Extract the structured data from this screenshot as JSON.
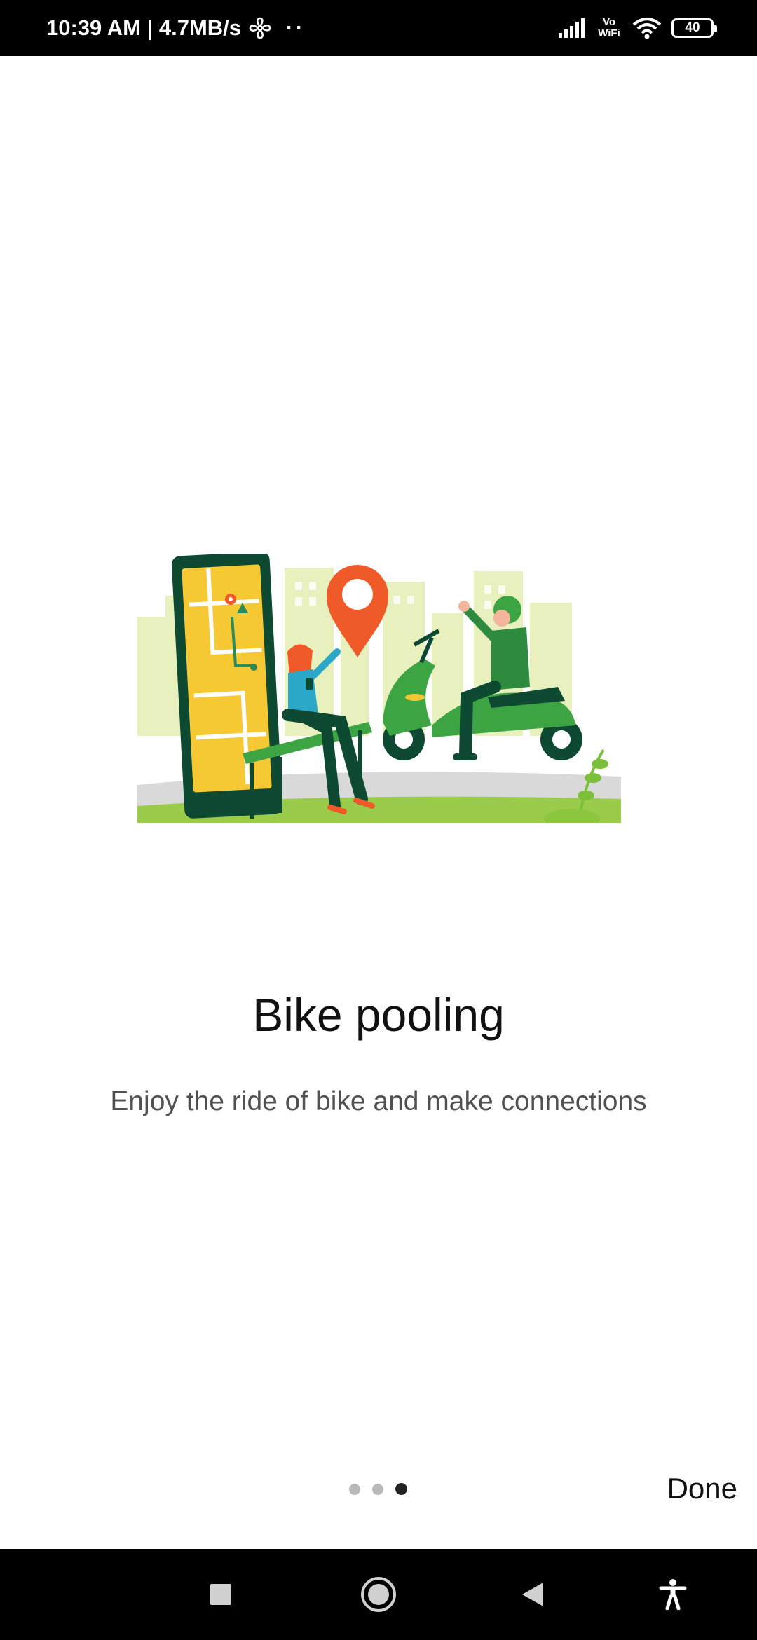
{
  "status_bar": {
    "time_speed": "10:39 AM | 4.7MB/s",
    "overflow_dots": "··",
    "vowifi_top": "Vo",
    "vowifi_bottom": "WiFi",
    "battery_level": "40",
    "icons": [
      "fan-icon",
      "signal-icon",
      "vowifi-icon",
      "wifi-icon",
      "battery-icon"
    ]
  },
  "onboarding": {
    "illustration": "bike-pooling-illustration",
    "title": "Bike pooling",
    "subtitle": "Enjoy the ride of bike and make connections",
    "pager": {
      "total": 3,
      "current": 3
    },
    "done_label": "Done"
  },
  "nav_bar": {
    "icons": [
      "recents-square-icon",
      "home-circle-icon",
      "back-triangle-icon",
      "accessibility-icon"
    ]
  },
  "colors": {
    "pin": "#F05A28",
    "scooter": "#3DA443",
    "phone_frame": "#0E4A32",
    "map_yellow": "#F6C833",
    "city": "#E5EFB8",
    "ground": "#8CC63F"
  }
}
